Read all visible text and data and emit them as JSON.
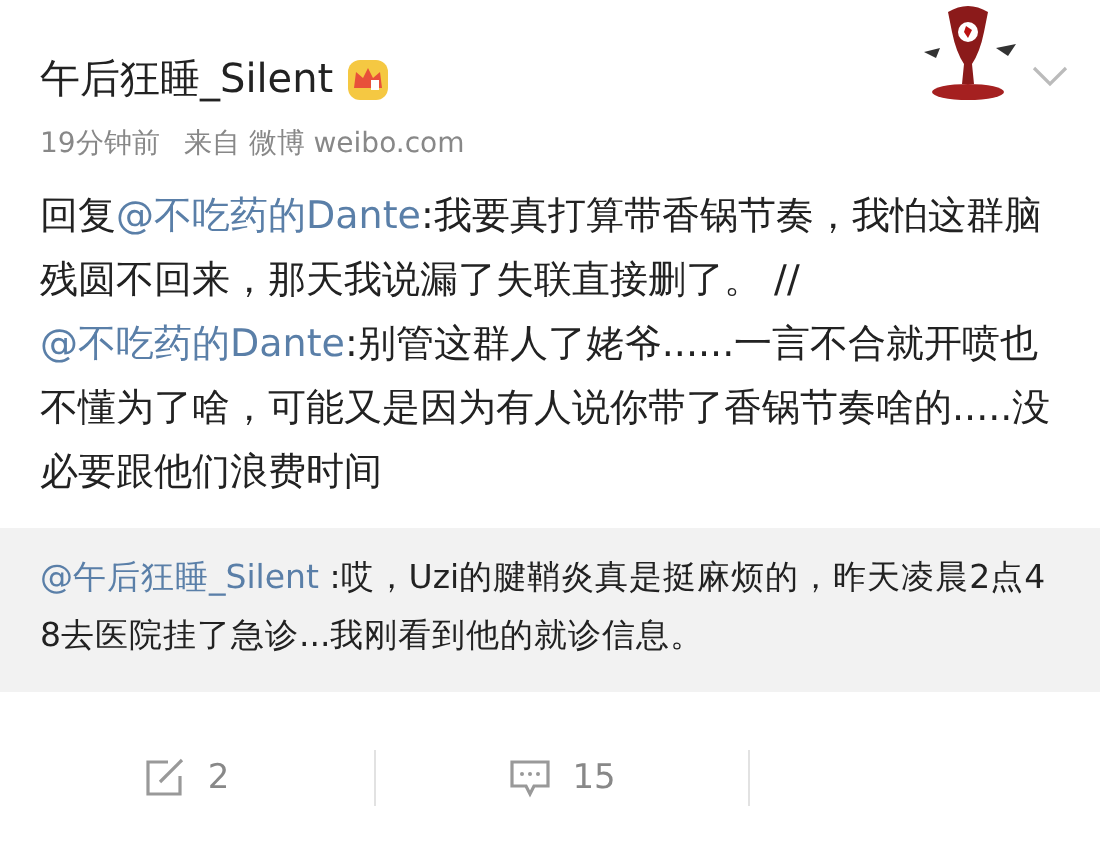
{
  "post": {
    "author": "午后狂睡_Silent",
    "time": "19分钟前",
    "source": "来自 微博 weibo.com",
    "body": [
      {
        "kind": "text",
        "text": "回复"
      },
      {
        "kind": "mention",
        "text": "@不吃药的Dante"
      },
      {
        "kind": "text",
        "text": ":我要真打算带香锅节奏，我怕这群脑残圆不回来，那天我说漏了失联直接删了。 //"
      },
      {
        "kind": "mention",
        "text": "@不吃药的Dante"
      },
      {
        "kind": "text",
        "text": ":别管这群人了姥爷......一言不合就开喷也不懂为了啥，可能又是因为有人说你带了香锅节奏啥的.....没必要跟他们浪费时间"
      }
    ],
    "quote": [
      {
        "kind": "mention",
        "text": "@午后狂睡_Silent"
      },
      {
        "kind": "text",
        "text": " :哎，Uzi的腱鞘炎真是挺麻烦的，昨天凌晨2点48去医院挂了急诊...我刚看到他的就诊信息。"
      }
    ],
    "actions": [
      {
        "kind": "repost",
        "count": "2"
      },
      {
        "kind": "comment",
        "count": "15"
      }
    ]
  }
}
